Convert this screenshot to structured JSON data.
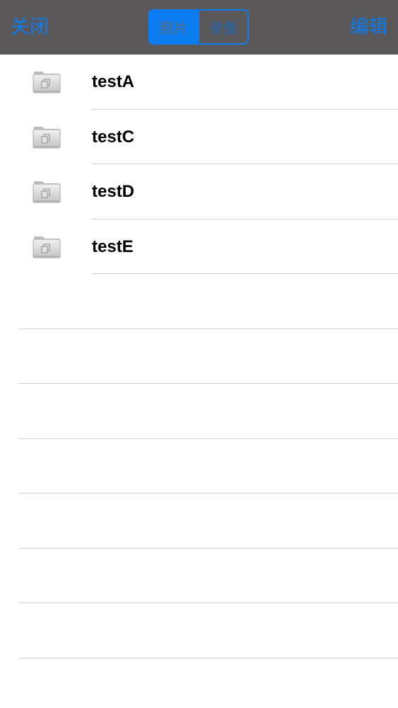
{
  "navbar": {
    "close_label": "关闭",
    "edit_label": "编辑",
    "segments": [
      {
        "label": "照片",
        "selected": true
      },
      {
        "label": "录像",
        "selected": false
      }
    ],
    "accent_color": "#0a7cf0",
    "background_color": "#5a5858"
  },
  "folders": [
    {
      "name": "testA",
      "icon": "folder-icon"
    },
    {
      "name": "testC",
      "icon": "folder-icon"
    },
    {
      "name": "testD",
      "icon": "folder-icon"
    },
    {
      "name": "testE",
      "icon": "folder-icon"
    }
  ]
}
